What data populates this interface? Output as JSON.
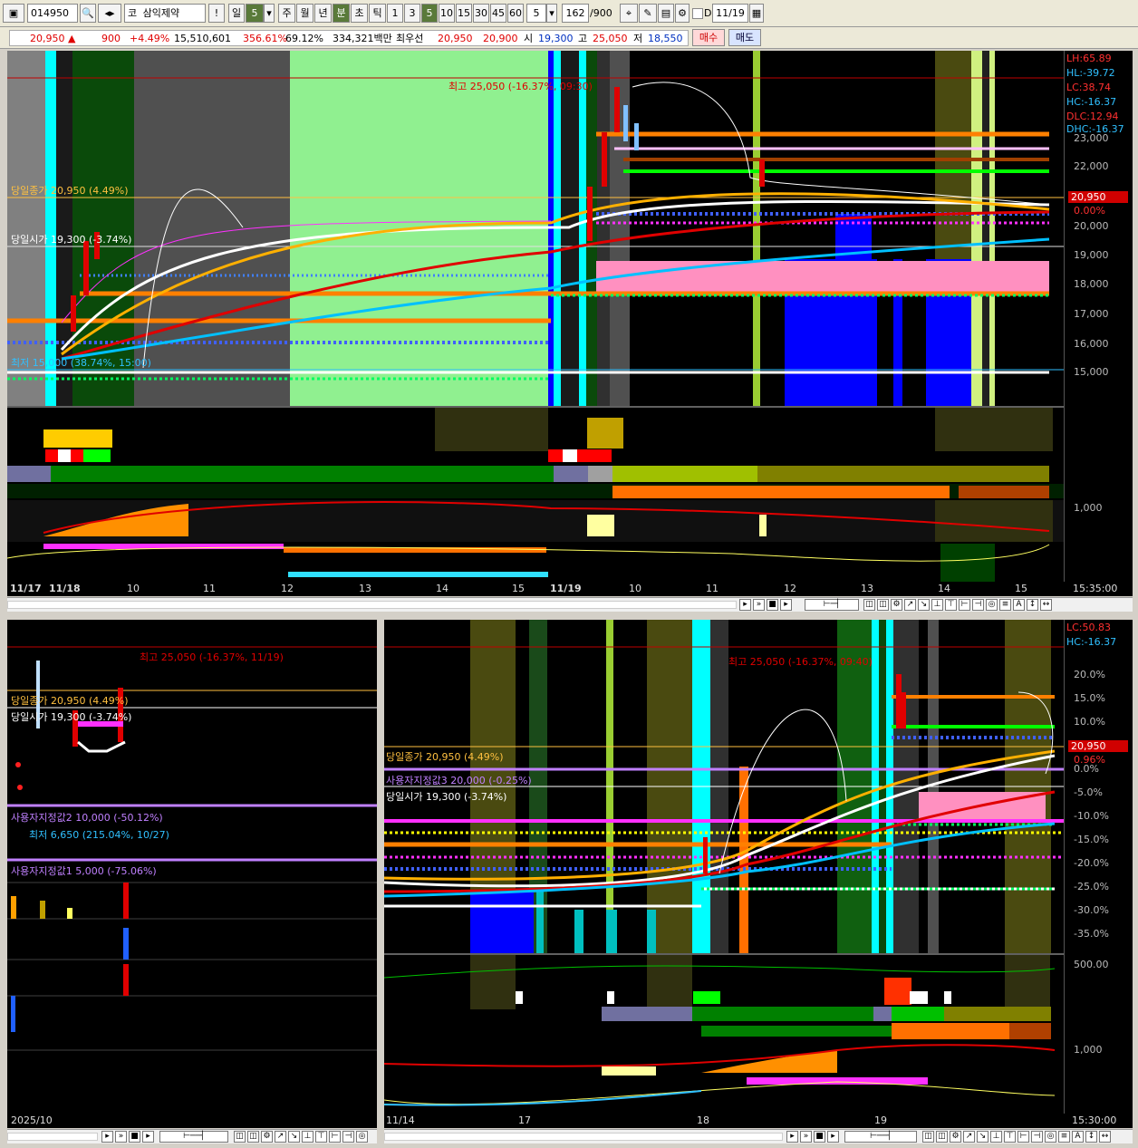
{
  "toolbar": {
    "code": "014950",
    "market": "코",
    "name": "삼익제약",
    "period_buttons": [
      "일",
      "5",
      "주",
      "월",
      "년",
      "분",
      "초",
      "틱",
      "1",
      "3",
      "5",
      "10",
      "15",
      "30",
      "45",
      "60"
    ],
    "interval": "5",
    "count": "162",
    "count_total": "/900",
    "date_d": "D",
    "date": "11/19",
    "exclaim": "!"
  },
  "quote": {
    "price": "20,950",
    "change": "900",
    "change_pct": "+4.49%",
    "volume": "15,510,601",
    "vol_ratio": "356.61%",
    "turnover": "69.12%",
    "amount": "334,321백만",
    "best_label": "최우선",
    "best_ask": "20,950",
    "best_bid": "20,900",
    "open_label": "시",
    "open": "19,300",
    "high_label": "고",
    "high": "25,050",
    "low_label": "저",
    "low": "18,550",
    "buy_label": "매수",
    "sell_label": "매도"
  },
  "top_chart": {
    "right_labels": [
      {
        "text": "LH:65.89",
        "color": "#ff3030"
      },
      {
        "text": "HL:-39.72",
        "color": "#30c0ff"
      },
      {
        "text": "LC:38.74",
        "color": "#ff3030"
      },
      {
        "text": "HC:-16.37",
        "color": "#30c0ff"
      },
      {
        "text": "DLC:12.94",
        "color": "#ff3030"
      },
      {
        "text": "DHC:-16.37",
        "color": "#30c0ff"
      }
    ],
    "y_ticks": [
      "23,000",
      "22,000",
      "21,000",
      "20,000",
      "19,000",
      "18,000",
      "17,000",
      "16,000",
      "15,000"
    ],
    "price_box": "20,950",
    "pct_box": "0.00%",
    "annotations": {
      "high": "최고 25,050 (-16.37%, 09:30)",
      "close": "당일종가 20,950 (4.49%)",
      "open": "당일시가 19,300 (-3.74%)",
      "low": "최저 15,000 (38.74%, 15:00)"
    },
    "sub_tick": "1,000",
    "x_ticks": [
      "11/17",
      "11/18",
      "10",
      "11",
      "12",
      "13",
      "14",
      "15",
      "11/19",
      "10",
      "11",
      "12",
      "13",
      "14",
      "15"
    ],
    "time": "15:35:00"
  },
  "left_chart": {
    "annotations": {
      "high": "최고 25,050 (-16.37%, 11/19)",
      "close": "당일종가 20,950 (4.49%)",
      "open": "당일시가 19,300 (-3.74%)",
      "user2": "사용자지정값2 10,000 (-50.12%)",
      "low": "최저 6,650 (215.04%, 10/27)",
      "user1": "사용자지정값1 5,000 (-75.06%)"
    },
    "x_label": "2025/10"
  },
  "right_chart": {
    "right_labels": [
      {
        "text": "LC:50.83",
        "color": "#ff3030"
      },
      {
        "text": "HC:-16.37",
        "color": "#30c0ff"
      }
    ],
    "y_ticks": [
      "20.0%",
      "15.0%",
      "10.0%",
      "5.0%",
      "0.0%",
      "-5.0%",
      "-10.0%",
      "-15.0%",
      "-20.0%",
      "-25.0%",
      "-30.0%",
      "-35.0%"
    ],
    "price_box": "20,950",
    "pct_box": "0.96%",
    "annotations": {
      "high": "최고 25,050 (-16.37%, 09:40)",
      "close": "당일종가 20,950 (4.49%)",
      "user3": "사용자지정값3 20,000 (-0.25%)",
      "open": "당일시가 19,300 (-3.74%)"
    },
    "sub_ticks": [
      "500.00",
      "1,000"
    ],
    "x_ticks": [
      "11/14",
      "17",
      "18",
      "19"
    ],
    "time": "15:30:00"
  },
  "colors": {
    "rise": "#e00000",
    "fall": "#0030c0",
    "orange": "#ff8c00",
    "cyan": "#00e0ff",
    "magenta": "#ff30ff",
    "green": "#00ff00",
    "yellow": "#ffff00"
  }
}
